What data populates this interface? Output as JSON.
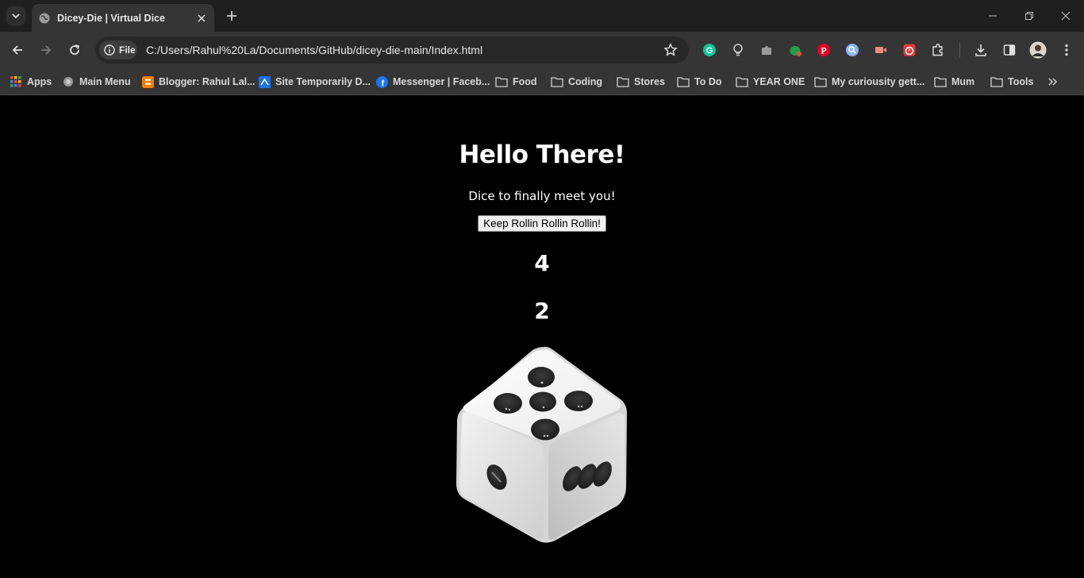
{
  "browser": {
    "tab_title": "Dicey-Die | Virtual Dice",
    "site_chip": "File",
    "url": "C:/Users/Rahul%20La/Documents/GitHub/dicey-die-main/Index.html"
  },
  "bookmarks": [
    {
      "label": "Apps",
      "icon": "apps-grid-icon"
    },
    {
      "label": "Main Menu",
      "icon": "globe-icon"
    },
    {
      "label": "Blogger: Rahul Lal...",
      "icon": "blogger-icon"
    },
    {
      "label": "Site Temporarily D...",
      "icon": "site-icon"
    },
    {
      "label": "Messenger | Faceb...",
      "icon": "facebook-icon"
    },
    {
      "label": "Food",
      "icon": "folder-icon"
    },
    {
      "label": "Coding",
      "icon": "folder-icon"
    },
    {
      "label": "Stores",
      "icon": "folder-icon"
    },
    {
      "label": "To Do",
      "icon": "folder-icon"
    },
    {
      "label": "YEAR ONE",
      "icon": "folder-icon"
    },
    {
      "label": "My curiousity gett...",
      "icon": "folder-icon"
    },
    {
      "label": "Mum",
      "icon": "folder-icon"
    },
    {
      "label": "Tools",
      "icon": "folder-icon"
    }
  ],
  "page": {
    "title": "Hello There!",
    "subtitle": "Dice to finally meet you!",
    "button_label": "Keep Rollin Rollin Rollin!",
    "result_1": "4",
    "result_2": "2"
  },
  "colors": {
    "page_background": "#000000",
    "chrome_dark": "#1f1f1f",
    "chrome_toolbar": "#353535",
    "text": "#ffffff"
  }
}
